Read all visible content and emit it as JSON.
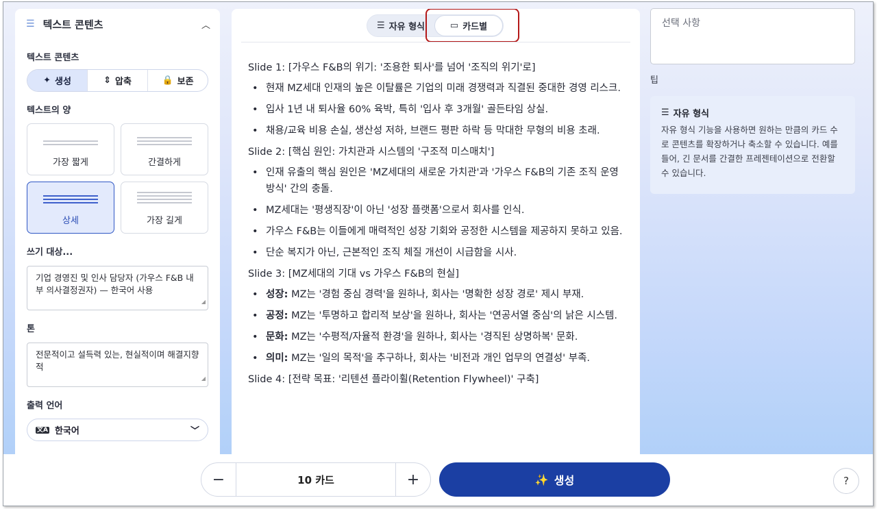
{
  "left_panel": {
    "header_title": "텍스트 콘텐츠",
    "text_content_label": "텍스트 콘텐츠",
    "modes": [
      {
        "icon": "sparkle-icon",
        "label": "생성",
        "active": true
      },
      {
        "icon": "compress-icon",
        "label": "압축",
        "active": false
      },
      {
        "icon": "lock-icon",
        "label": "보존",
        "active": false
      }
    ],
    "amount_label": "텍스트의 양",
    "amounts": [
      {
        "label": "가장 짧게",
        "active": false
      },
      {
        "label": "간결하게",
        "active": false
      },
      {
        "label": "상세",
        "active": true
      },
      {
        "label": "가장 길게",
        "active": false
      }
    ],
    "audience_label": "쓰기 대상...",
    "audience_value": "기업 경영진 및 인사 담당자 (가우스 F&B 내부 의사결정권자) — 한국어 사용",
    "tone_label": "톤",
    "tone_value": "전문적이고 설득력 있는, 현실적이며 해결지향적",
    "language_label": "출력 언어",
    "language_value": "한국어"
  },
  "center": {
    "toggle_free": "자유 형식",
    "toggle_card": "카드별",
    "slides": [
      {
        "title": "Slide 1: [가우스 F&B의 위기: '조용한 퇴사'를 넘어 '조직의 위기'로]",
        "bullets": [
          {
            "bold": "",
            "text": "현재 MZ세대 인재의 높은 이탈률은 기업의 미래 경쟁력과 직결된 중대한 경영 리스크."
          },
          {
            "bold": "",
            "text": "입사 1년 내 퇴사율 60% 육박, 특히 '입사 후 3개월' 골든타임 상실."
          },
          {
            "bold": "",
            "text": "채용/교육 비용 손실, 생산성 저하, 브랜드 평판 하락 등 막대한 무형의 비용 초래."
          }
        ]
      },
      {
        "title": "Slide 2: [핵심 원인: 가치관과 시스템의 '구조적 미스매치']",
        "bullets": [
          {
            "bold": "",
            "text": "인재 유출의 핵심 원인은 'MZ세대의 새로운 가치관'과 '가우스 F&B의 기존 조직 운영 방식' 간의 충돌."
          },
          {
            "bold": "",
            "text": "MZ세대는 '평생직장'이 아닌 '성장 플랫폼'으로서 회사를 인식."
          },
          {
            "bold": "",
            "text": "가우스 F&B는 이들에게 매력적인 성장 기회와 공정한 시스템을 제공하지 못하고 있음."
          },
          {
            "bold": "",
            "text": "단순 복지가 아닌, 근본적인 조직 체질 개선이 시급함을 시사."
          }
        ]
      },
      {
        "title": "Slide 3: [MZ세대의 기대 vs 가우스 F&B의 현실]",
        "bullets": [
          {
            "bold": "성장:",
            "text": " MZ는 '경험 중심 경력'을 원하나, 회사는 '명확한 성장 경로' 제시 부재."
          },
          {
            "bold": "공정:",
            "text": " MZ는 '투명하고 합리적 보상'을 원하나, 회사는 '연공서열 중심'의 낡은 시스템."
          },
          {
            "bold": "문화:",
            "text": " MZ는 '수평적/자율적 환경'을 원하나, 회사는 '경직된 상명하복' 문화."
          },
          {
            "bold": "의미:",
            "text": " MZ는 '일의 목적'을 추구하나, 회사는 '비전과 개인 업무의 연결성' 부족."
          }
        ]
      },
      {
        "title": "Slide 4: [전략 목표: '리텐션 플라이휠(Retention Flywheel)' 구축]",
        "bullets": []
      }
    ]
  },
  "right_panel": {
    "selection_placeholder": "선택 사항",
    "tip_label": "팁",
    "tip_title": "자유 형식",
    "tip_body": "자유 형식 기능을 사용하면 원하는 만큼의 카드 수로 콘텐츠를 확장하거나 축소할 수 있습니다. 예를 들어, 긴 문서를 간결한 프레젠테이션으로 전환할 수 있습니다."
  },
  "bottom": {
    "minus": "−",
    "card_count": "10 카드",
    "plus": "+",
    "generate_label": "생성",
    "help": "?"
  }
}
